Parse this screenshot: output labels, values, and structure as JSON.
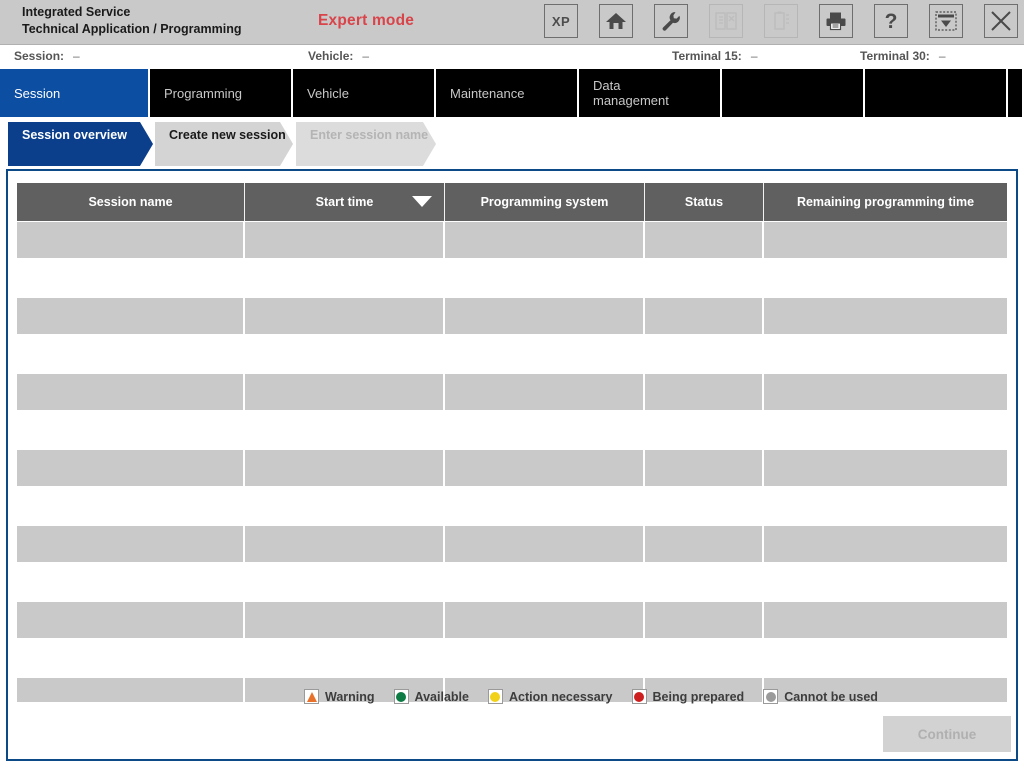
{
  "header": {
    "title_line1": "Integrated Service",
    "title_line2": "Technical Application / Programming",
    "mode_label": "Expert mode",
    "toolbar": [
      {
        "name": "xp-button",
        "label": "XP",
        "icon": "xp-icon",
        "disabled": false
      },
      {
        "name": "home-button",
        "label": "Home",
        "icon": "home-icon",
        "disabled": false
      },
      {
        "name": "tools-button",
        "label": "Tools",
        "icon": "wrench-icon",
        "disabled": false
      },
      {
        "name": "documents-button",
        "label": "Documents",
        "icon": "documents-icon",
        "disabled": true
      },
      {
        "name": "battery-button",
        "label": "Battery",
        "icon": "battery-icon",
        "disabled": true
      },
      {
        "name": "print-button",
        "label": "Print",
        "icon": "printer-icon",
        "disabled": false
      },
      {
        "name": "help-button",
        "label": "Help",
        "icon": "question-icon",
        "disabled": false
      },
      {
        "name": "minimize-button",
        "label": "Minimize",
        "icon": "minimize-icon",
        "disabled": false
      },
      {
        "name": "close-button",
        "label": "Close",
        "icon": "close-icon",
        "disabled": false
      }
    ]
  },
  "status": {
    "session_label": "Session:",
    "session_value": "–",
    "vehicle_label": "Vehicle:",
    "vehicle_value": "–",
    "terminal15_label": "Terminal 15:",
    "terminal15_value": "–",
    "terminal30_label": "Terminal 30:",
    "terminal30_value": "–"
  },
  "mainnav": {
    "tabs": [
      {
        "label": "Session",
        "active": true
      },
      {
        "label": "Programming",
        "active": false
      },
      {
        "label": "Vehicle",
        "active": false
      },
      {
        "label": "Maintenance",
        "active": false
      },
      {
        "label": "Data\nmanagement",
        "active": false
      },
      {
        "label": "",
        "active": false
      },
      {
        "label": "",
        "active": false
      },
      {
        "label": "",
        "active": false
      }
    ]
  },
  "subnav": {
    "tabs": [
      {
        "label": "Session overview",
        "state": "active"
      },
      {
        "label": "Create new session",
        "state": "idle"
      },
      {
        "label": "Enter session name",
        "state": "dim"
      }
    ]
  },
  "table": {
    "columns": [
      "Session name",
      "Start time",
      "Programming system",
      "Status",
      "Remaining programming time"
    ],
    "sort_column": "Start time",
    "sort_direction": "descending",
    "rows": [
      {
        "session_name": "",
        "start_time": "",
        "programming_system": "",
        "status": "",
        "remaining_programming_time": ""
      },
      {
        "session_name": "",
        "start_time": "",
        "programming_system": "",
        "status": "",
        "remaining_programming_time": ""
      },
      {
        "session_name": "",
        "start_time": "",
        "programming_system": "",
        "status": "",
        "remaining_programming_time": ""
      },
      {
        "session_name": "",
        "start_time": "",
        "programming_system": "",
        "status": "",
        "remaining_programming_time": ""
      },
      {
        "session_name": "",
        "start_time": "",
        "programming_system": "",
        "status": "",
        "remaining_programming_time": ""
      },
      {
        "session_name": "",
        "start_time": "",
        "programming_system": "",
        "status": "",
        "remaining_programming_time": ""
      },
      {
        "session_name": "",
        "start_time": "",
        "programming_system": "",
        "status": "",
        "remaining_programming_time": ""
      }
    ]
  },
  "legend": {
    "items": [
      {
        "label": "Warning",
        "icon": "warning-triangle-icon",
        "color": "#e8722b"
      },
      {
        "label": "Available",
        "icon": "status-dot-icon",
        "color": "#0e7a44"
      },
      {
        "label": "Action necessary",
        "icon": "status-dot-icon",
        "color": "#f2d218"
      },
      {
        "label": "Being prepared",
        "icon": "status-dot-icon",
        "color": "#cc1f1f"
      },
      {
        "label": "Cannot be used",
        "icon": "status-dot-icon",
        "color": "#9a9a9a"
      }
    ]
  },
  "footer": {
    "continue_label": "Continue",
    "continue_disabled": true
  },
  "theme": {
    "accent_blue": "#0b4ea2",
    "panel_border": "#0b4a86",
    "header_gray": "#c9c9c9",
    "table_header_gray": "#606060",
    "row_gray": "#c9c9c9",
    "expert_red": "#d9434a"
  }
}
